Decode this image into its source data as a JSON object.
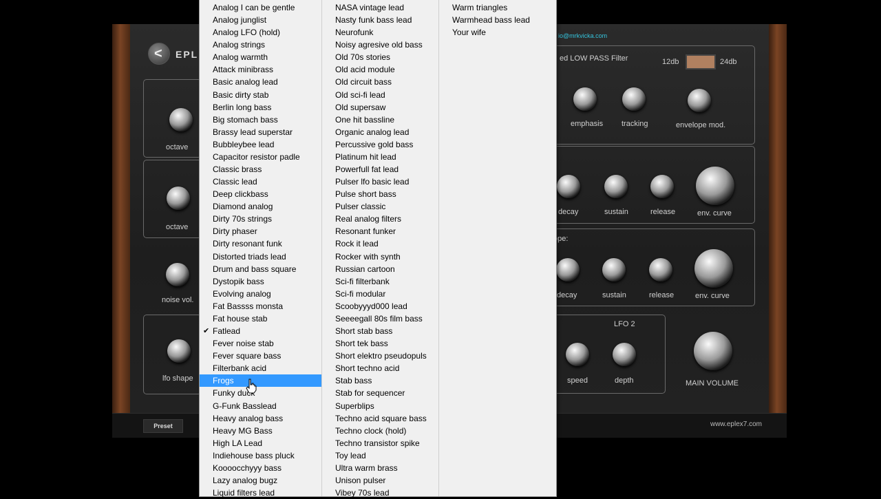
{
  "synth": {
    "logo_text": "EPLE",
    "email": "io@mrkvicka.com",
    "filter_title": "ed LOW PASS Filter",
    "filter_12db": "12db",
    "filter_24db": "24db",
    "env1_title": "",
    "env2_title": "ope:",
    "lfo2_title": "LFO 2",
    "preset_button": "Preset",
    "website": "www.eplex7.com",
    "labels": {
      "octave1": "octave",
      "octave2": "octave",
      "noise_vol": "noise vol.",
      "lfo_shape": "lfo shape",
      "emphasis": "emphasis",
      "tracking": "tracking",
      "envelope_mod": "envelope mod.",
      "decay1": "decay",
      "sustain1": "sustain",
      "release1": "release",
      "env_curve1": "env. curve",
      "decay2": "decay",
      "sustain2": "sustain",
      "release2": "release",
      "env_curve2": "env. curve",
      "speed": "speed",
      "depth": "depth",
      "main_volume": "MAIN VOLUME"
    }
  },
  "menu": {
    "selected": "Frogs",
    "checked": "Fatlead",
    "columns": [
      [
        "Analog I can be gentle",
        "Analog junglist",
        "Analog LFO (hold)",
        "Analog strings",
        "Analog warmth",
        "Attack minibrass",
        "Basic analog lead",
        "Basic dirty stab",
        "Berlin long bass",
        "Big stomach bass",
        "Brassy lead superstar",
        "Bubbleybee lead",
        "Capacitor resistor padle",
        "Classic brass",
        "Classic lead",
        "Deep clickbass",
        "Diamond analog",
        "Dirty 70s strings",
        "Dirty phaser",
        "Dirty resonant funk",
        "Distorted triads lead",
        "Drum and bass square",
        "Dystopik bass",
        "Evolving analog",
        "Fat Bassss monsta",
        "Fat house stab",
        "Fatlead",
        "Fever noise stab",
        "Fever square bass",
        "Filterbank acid",
        "Frogs",
        "Funky duck",
        "G-Funk Basslead",
        "Heavy analog bass",
        "Heavy MG Bass",
        "High LA Lead",
        "Indiehouse bass pluck",
        "Koooocchyyy bass",
        "Lazy analog bugz",
        "Liquid filters lead"
      ],
      [
        "NASA vintage lead",
        "Nasty funk bass lead",
        "Neurofunk",
        "Noisy agresive old bass",
        "Old 70s stories",
        "Old acid module",
        "Old circuit bass",
        "Old sci-fi lead",
        "Old supersaw",
        "One hit bassline",
        "Organic analog lead",
        "Percussive gold bass",
        "Platinum hit lead",
        "Powerfull fat lead",
        "Pulser lfo basic lead",
        "Pulse short bass",
        "Pulser classic",
        "Real analog filters",
        "Resonant funker",
        "Rock it lead",
        "Rocker with synth",
        "Russian cartoon",
        "Sci-fi filterbank",
        "Sci-fi modular",
        "Scoobyyyd000 lead",
        "Seeeegall 80s film bass",
        "Short stab bass",
        "Short tek bass",
        "Short elektro pseudopuls",
        "Short techno acid",
        "Stab bass",
        "Stab for sequencer",
        "Superblips",
        "Techno acid square bass",
        "Techno clock (hold)",
        "Techno transistor spike",
        "Toy lead",
        "Ultra warm brass",
        "Unison pulser",
        "Vibey 70s lead"
      ],
      [
        "Warm triangles",
        "Warmhead bass lead",
        "Your wife"
      ]
    ]
  }
}
